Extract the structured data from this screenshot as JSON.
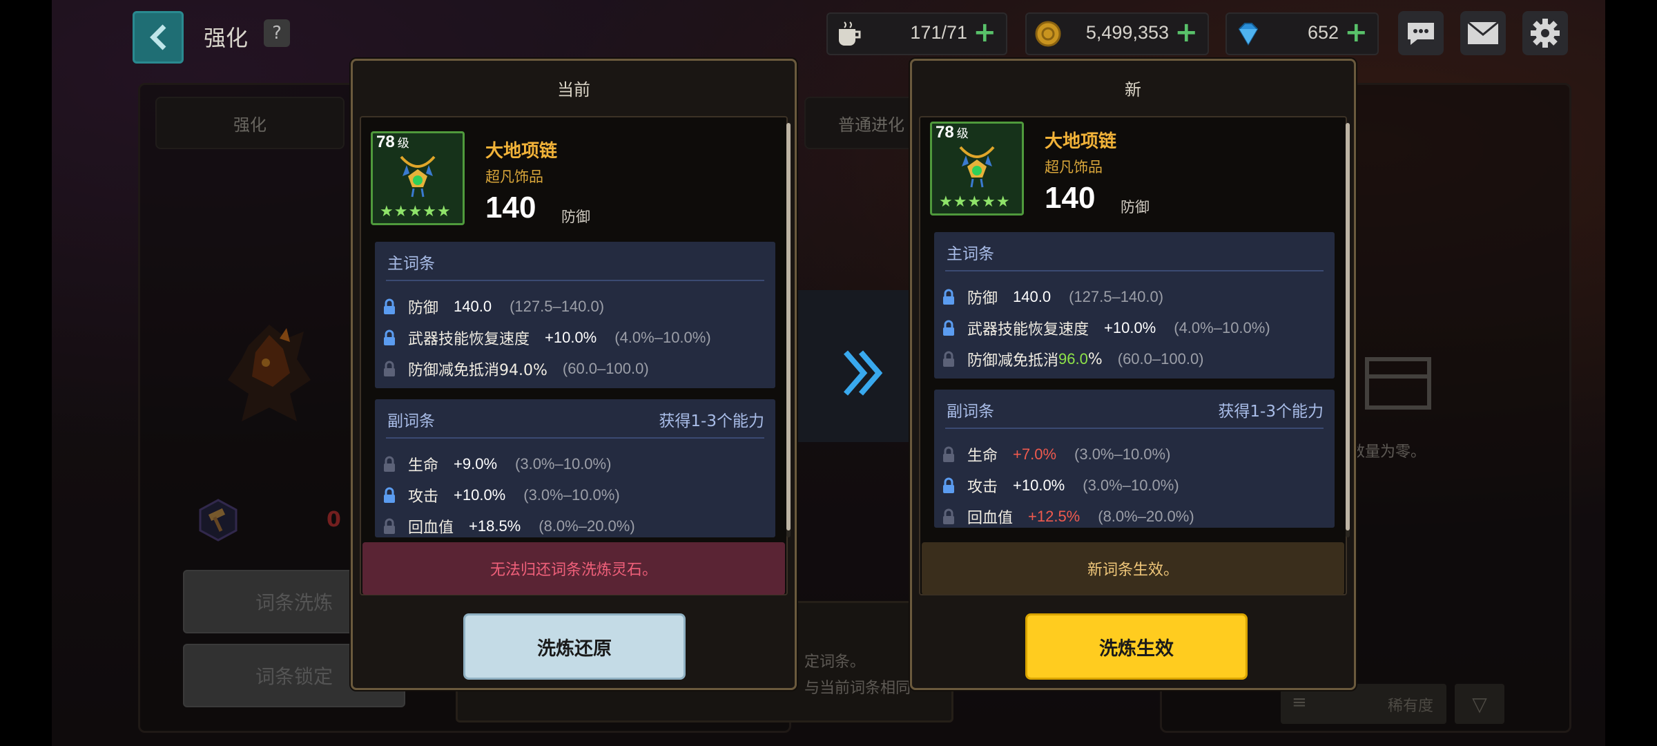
{
  "topbar": {
    "title": "强化",
    "help": "?",
    "stamina": "171/71",
    "gold": "5,499,353",
    "gems": "652"
  },
  "background": {
    "tab_enhance": "强化",
    "tab_evolve": "普通进化",
    "btn_reforge": "词条洗炼",
    "btn_lock": "词条锁定",
    "hint_right": "数量为零。",
    "hint_bottom_1": "定词条。",
    "hint_bottom_2": "与当前词条相同",
    "sort_label": "稀有度",
    "partial_value": "0"
  },
  "current": {
    "title": "当前",
    "level": "78",
    "level_unit": "级",
    "stars": "★★★★★",
    "item_name": "大地项链",
    "item_type": "超凡饰品",
    "main_value": "140",
    "main_label": "防御",
    "main_header": "主词条",
    "main_stats": [
      {
        "name": "防御",
        "value": "140.0",
        "range": "(127.5–140.0)"
      },
      {
        "name": "武器技能恢复速度",
        "value": "+10.0%",
        "range": "(4.0%–10.0%)"
      },
      {
        "name": "防御减免抵消94.0%",
        "value": "",
        "range": "(60.0–100.0)"
      }
    ],
    "sub_header": "副词条",
    "sub_header_right": "获得1-3个能力",
    "sub_stats": [
      {
        "name": "生命",
        "value": "+9.0%",
        "range": "(3.0%–10.0%)"
      },
      {
        "name": "攻击",
        "value": "+10.0%",
        "range": "(3.0%–10.0%)"
      },
      {
        "name": "回血值",
        "value": "+18.5%",
        "range": "(8.0%–20.0%)"
      }
    ],
    "note": "无法归还词条洗炼灵石。",
    "button": "洗炼还原"
  },
  "new": {
    "title": "新",
    "level": "78",
    "level_unit": "级",
    "stars": "★★★★★",
    "item_name": "大地项链",
    "item_type": "超凡饰品",
    "main_value": "140",
    "main_label": "防御",
    "main_header": "主词条",
    "main_stats": [
      {
        "name": "防御",
        "value": "140.0",
        "range": "(127.5–140.0)"
      },
      {
        "name": "武器技能恢复速度",
        "value": "+10.0%",
        "range": "(4.0%–10.0%)"
      },
      {
        "name": "防御减免抵消",
        "value_green": "96.0",
        "value_suffix": "%",
        "range": "(60.0–100.0)"
      }
    ],
    "sub_header": "副词条",
    "sub_header_right": "获得1-3个能力",
    "sub_stats": [
      {
        "name": "生命",
        "value": "+7.0%",
        "range": "(3.0%–10.0%)"
      },
      {
        "name": "攻击",
        "value": "+10.0%",
        "range": "(3.0%–10.0%)"
      },
      {
        "name": "回血值",
        "value": "+12.5%",
        "range": "(8.0%–20.0%)"
      }
    ],
    "note": "新词条生效。",
    "button": "洗炼生效"
  },
  "colors": {
    "accent_yellow": "#ffcc1f",
    "restore_button": "#c4dbe6",
    "note_red_bg": "#5a2434",
    "note_gold_bg": "#3a2e1c"
  }
}
